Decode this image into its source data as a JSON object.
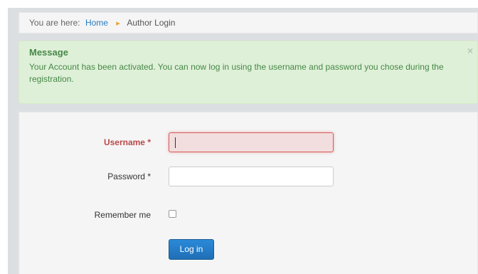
{
  "breadcrumb": {
    "prefix": "You are here:",
    "home_label": "Home",
    "separator_icon": "caret-right-icon",
    "current_label": "Author Login"
  },
  "message": {
    "heading": "Message",
    "text": "Your Account has been activated. You can now log in using the username and password you chose during the registration.",
    "close_label": "×"
  },
  "login_form": {
    "username_label": "Username *",
    "username_value": "",
    "password_label": "Password *",
    "password_value": "",
    "remember_label": "Remember me",
    "remember_checked": false,
    "submit_label": "Log in"
  },
  "colors": {
    "success_bg": "#dff0d8",
    "success_text": "#468847",
    "error_text": "#b94a48",
    "error_field_bg": "#f2dede",
    "primary_button": "#1f6fb5",
    "link": "#2a7bbf",
    "separator": "#f09b2a"
  }
}
